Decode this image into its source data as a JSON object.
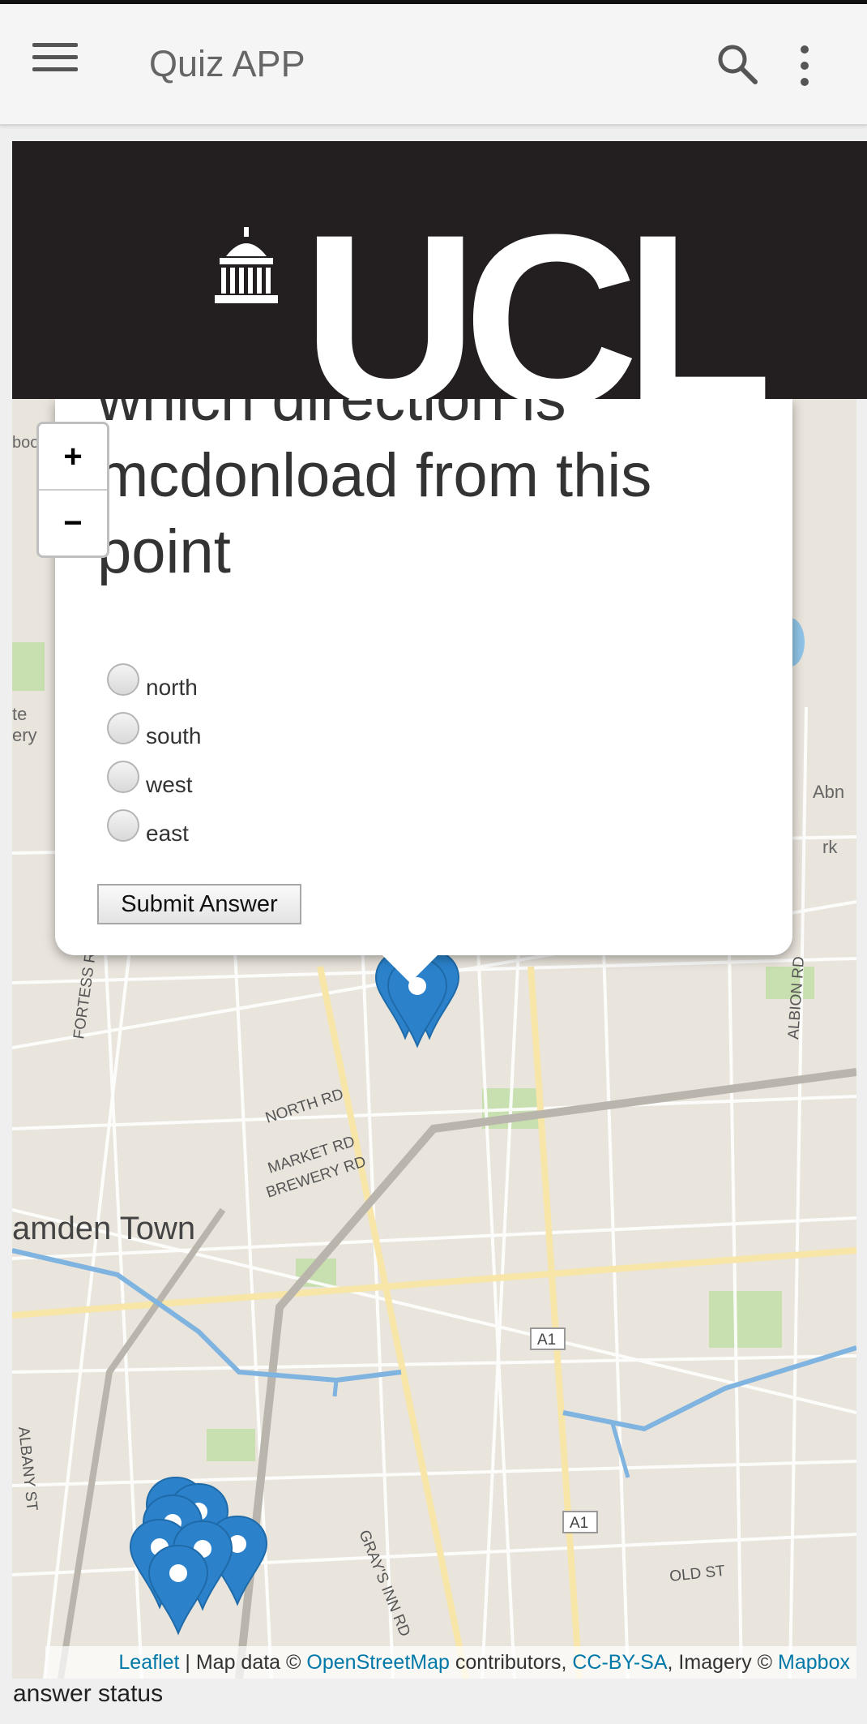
{
  "app": {
    "title": "Quiz APP"
  },
  "logo": {
    "text": "UCL"
  },
  "map": {
    "zoom_in": "+",
    "zoom_out": "−",
    "labels": {
      "camden": "amden Town",
      "north_rd": "NORTH RD",
      "market_rd": "MARKET RD",
      "brewery_rd": "BREWERY RD",
      "fortess_rd": "FORTESS R",
      "albion_rd": "ALBION RD",
      "albany_st": "ALBANY ST",
      "grays_inn_rd": "GRAY'S INN RD",
      "old_st": "OLD ST",
      "a1": "A1",
      "ate": "te",
      "ery": "ery",
      "abn": "Abn",
      "rk": "rk",
      "boo": "boo"
    },
    "attribution": {
      "leaflet": "Leaflet",
      "sep": " | Map data © ",
      "osm": "OpenStreetMap",
      "contrib": " contributors, ",
      "license": "CC-BY-SA",
      "imagery": ", Imagery © ",
      "mapbox": "Mapbox"
    }
  },
  "quiz": {
    "question": "which direction is mcdonload from this point",
    "options": [
      "north",
      "south",
      "west",
      "east"
    ],
    "submit_label": "Submit Answer"
  },
  "status": {
    "answer_status": "answer status"
  },
  "colors": {
    "marker": "#2b82cb",
    "logo_bg": "#231f20",
    "link": "#0078a8"
  }
}
